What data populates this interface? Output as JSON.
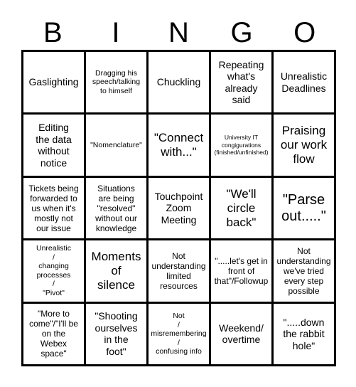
{
  "card": {
    "title_letters": [
      "B",
      "I",
      "N",
      "G",
      "O"
    ],
    "columns": 5,
    "rows": 5,
    "colors": {
      "background": "#ffffff",
      "border": "#000000",
      "text": "#000000"
    },
    "cells": [
      [
        {
          "text": "Gaslighting",
          "size": "lg"
        },
        {
          "text": "Dragging his\nspeech/talking\nto himself",
          "size": "sm"
        },
        {
          "text": "Chuckling",
          "size": "lg"
        },
        {
          "text": "Repeating\nwhat's\nalready\nsaid",
          "size": "lg"
        },
        {
          "text": "Unrealistic\nDeadlines",
          "size": "lg"
        }
      ],
      [
        {
          "text": "Editing\nthe data\nwithout\nnotice",
          "size": "lg"
        },
        {
          "text": "\"Nomenclature\"",
          "size": "sm"
        },
        {
          "text": "\"Connect\nwith...\"",
          "size": "xl"
        },
        {
          "text": "University IT\ncongigurations\n(finished/unfinished)",
          "size": "xs"
        },
        {
          "text": "Praising\nour work\nflow",
          "size": "xl"
        }
      ],
      [
        {
          "text": "Tickets being\nforwarded to\nus when it's\nmostly not\nour issue",
          "size": "md"
        },
        {
          "text": "Situations\nare being\n\"resolved\"\nwithout our\nknowledge",
          "size": "md"
        },
        {
          "text": "Touchpoint\nZoom\nMeeting",
          "size": "lg"
        },
        {
          "text": "\"We'll\ncircle\nback\"",
          "size": "xl"
        },
        {
          "text": "\"Parse\nout.....\"",
          "size": "xxl"
        }
      ],
      [
        {
          "text": "Unrealistic\n/\nchanging\nprocesses\n/\n\"Pivot\"",
          "size": "sm"
        },
        {
          "text": "Moments\nof\nsilence",
          "size": "xl"
        },
        {
          "text": "Not\nunderstanding\nlimited\nresources",
          "size": "md"
        },
        {
          "text": "\".....let's get in\nfront of\nthat\"/Followup",
          "size": "md"
        },
        {
          "text": "Not\nunderstanding\nwe've tried\nevery step\npossible",
          "size": "md"
        }
      ],
      [
        {
          "text": "\"More to\ncome\"/\"I'll be\non the\nWebex\nspace\"",
          "size": "md"
        },
        {
          "text": "\"Shooting\nourselves\nin the\nfoot\"",
          "size": "lg"
        },
        {
          "text": "Not\n/\nmisremembering\n/\nconfusing info",
          "size": "sm"
        },
        {
          "text": "Weekend/\novertime",
          "size": "lg"
        },
        {
          "text": "\".....down\nthe rabbit\nhole\"",
          "size": "lg"
        }
      ]
    ]
  }
}
